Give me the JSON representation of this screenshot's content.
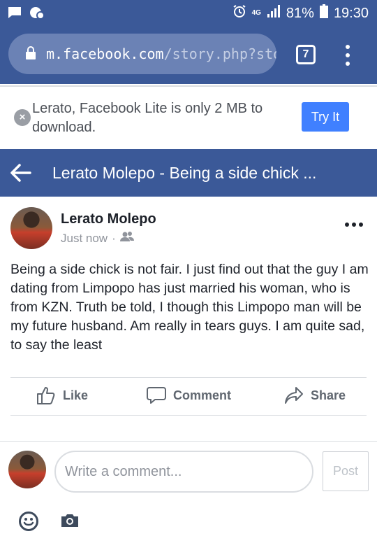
{
  "status_bar": {
    "network": "4G",
    "battery": "81%",
    "time": "19:30"
  },
  "browser": {
    "url_domain": "m.facebook.com",
    "url_path": "/story.php?sto",
    "tab_count": "7"
  },
  "banner": {
    "message": "Lerato, Facebook Lite is only 2 MB to download.",
    "try_label": "Try It"
  },
  "header": {
    "title": "Lerato Molepo - Being a side chick ..."
  },
  "post": {
    "author": "Lerato Molepo",
    "timestamp": "Just now",
    "privacy_separator": "·",
    "privacy_icon": "friends-icon",
    "text": "Being a side chick is not fair. I just find out that the guy I am dating from Limpopo has just married his woman, who is from KZN. Truth be told, I though this Limpopo man will be my future husband. Am really in tears guys. I am quite sad, to say the least"
  },
  "actions": {
    "like": "Like",
    "comment": "Comment",
    "share": "Share"
  },
  "composer": {
    "placeholder": "Write a comment...",
    "post_label": "Post"
  },
  "colors": {
    "brand": "#3b5998",
    "accent": "#4080ff",
    "muted": "#90949c"
  }
}
